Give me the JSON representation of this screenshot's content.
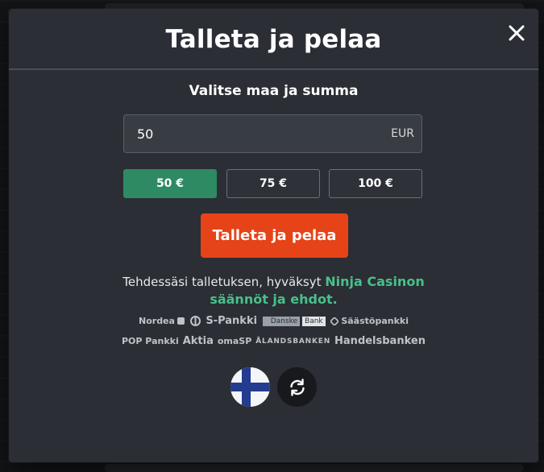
{
  "modal": {
    "title": "Talleta ja pelaa",
    "subtitle": "Valitse maa ja summa"
  },
  "amount": {
    "value": "50",
    "currency": "EUR"
  },
  "presets": [
    {
      "label": "50 €",
      "selected": true
    },
    {
      "label": "75 €",
      "selected": false
    },
    {
      "label": "100 €",
      "selected": false
    }
  ],
  "cta": {
    "label": "Talleta ja pelaa"
  },
  "terms": {
    "text": "Tehdessäsi talletuksen, hyväksyt",
    "link_brand": "Ninja Casinon",
    "link_terms": "säännöt ja ehdot."
  },
  "banks": {
    "row1": [
      {
        "name": "Nordea"
      },
      {
        "name": "op-icon"
      },
      {
        "name": "S-Pankki"
      },
      {
        "left": "Danske",
        "right": "Bank"
      },
      {
        "name": "Säästöpankki"
      }
    ],
    "row2": [
      {
        "name": "POP Pankki"
      },
      {
        "name": "Aktia"
      },
      {
        "name": "omaSP"
      },
      {
        "name": "ÅLANDSBANKEN"
      },
      {
        "name": "Handelsbanken"
      }
    ]
  },
  "colors": {
    "modal_bg": "#2b2e34",
    "accent_green": "#2e8a62",
    "link_green": "#48c08a",
    "cta_orange": "#e64318"
  },
  "icons": {
    "close": "close-icon",
    "country": "finland-flag-icon",
    "refresh": "refresh-icon"
  }
}
